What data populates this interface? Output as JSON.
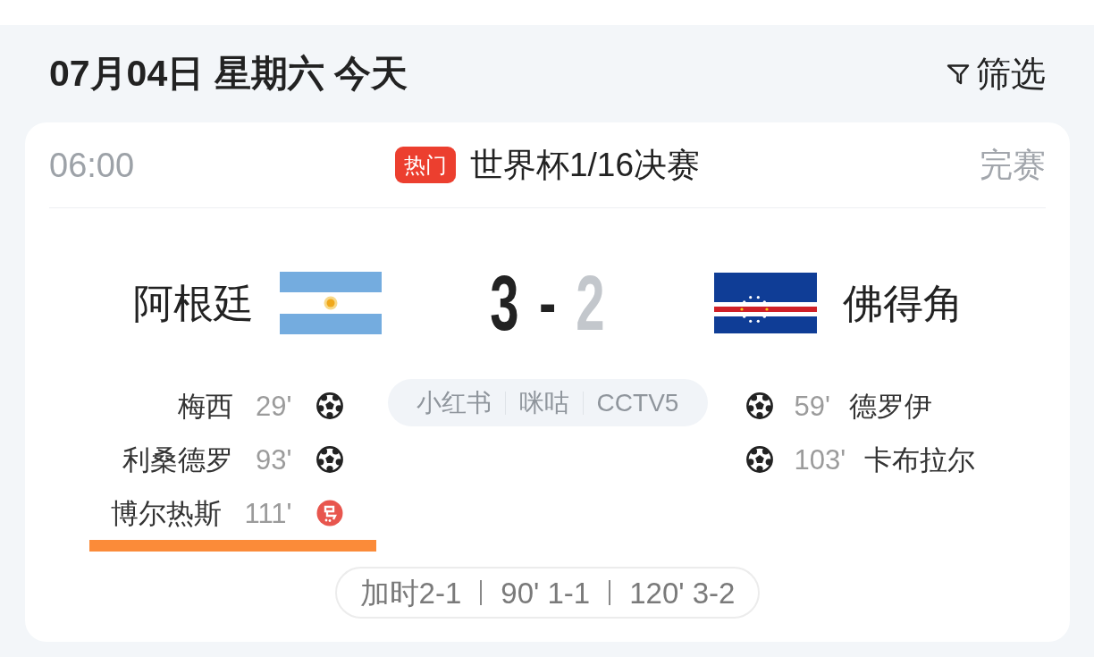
{
  "header": {
    "date": "07月04日 星期六 今天",
    "filter": {
      "label": "筛选"
    }
  },
  "match": {
    "time": "06:00",
    "badge": "热门",
    "competition": "世界杯1/16决赛",
    "status": "完赛",
    "home": {
      "name": "阿根廷"
    },
    "away": {
      "name": "佛得角"
    },
    "score": {
      "home": {
        "value": "3",
        "leading": true
      },
      "separator": "-",
      "away": {
        "value": "2",
        "leading": false
      }
    },
    "home_goals": [
      {
        "player": "梅西",
        "minute": "29'",
        "kind": "goal",
        "highlighted": false
      },
      {
        "player": "利桑德罗",
        "minute": "93'",
        "kind": "goal",
        "highlighted": false
      },
      {
        "player": "博尔热斯",
        "minute": "111'",
        "kind": "penalty",
        "highlighted": true
      }
    ],
    "away_goals": [
      {
        "player": "德罗伊",
        "minute": "59'",
        "kind": "goal",
        "highlighted": false
      },
      {
        "player": "卡布拉尔",
        "minute": "103'",
        "kind": "goal",
        "highlighted": false
      }
    ],
    "broadcasts": [
      "小红书",
      "咪咕",
      "CCTV5"
    ],
    "period_scores": [
      "加时2-1",
      "90' 1-1",
      "120' 3-2"
    ]
  }
}
